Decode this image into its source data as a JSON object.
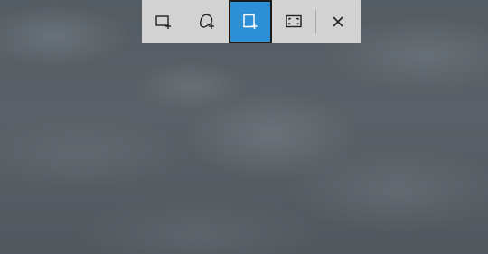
{
  "snip_toolbar": {
    "modes": [
      {
        "id": "rectangular",
        "icon": "rectangular-snip-icon",
        "active": false
      },
      {
        "id": "freeform",
        "icon": "freeform-snip-icon",
        "active": false
      },
      {
        "id": "window",
        "icon": "window-snip-icon",
        "active": true
      },
      {
        "id": "fullscreen",
        "icon": "fullscreen-snip-icon",
        "active": false
      }
    ],
    "close_icon": "close-icon"
  },
  "colors": {
    "toolbar_bg": "#d2d2d2",
    "active_bg": "#2d8fd5",
    "active_border": "#1a1a1a",
    "icon_color": "#222222",
    "active_icon_color": "#ffffff"
  }
}
